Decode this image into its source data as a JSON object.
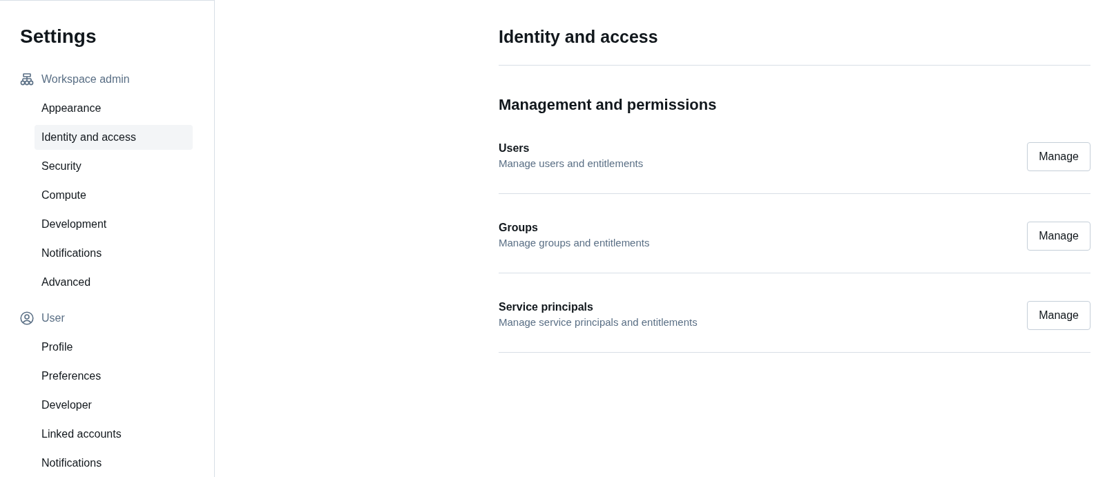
{
  "sidebar": {
    "title": "Settings",
    "sections": [
      {
        "label": "Workspace admin",
        "kind": "workspace",
        "items": [
          {
            "label": "Appearance",
            "selected": false
          },
          {
            "label": "Identity and access",
            "selected": true
          },
          {
            "label": "Security",
            "selected": false
          },
          {
            "label": "Compute",
            "selected": false
          },
          {
            "label": "Development",
            "selected": false
          },
          {
            "label": "Notifications",
            "selected": false
          },
          {
            "label": "Advanced",
            "selected": false
          }
        ]
      },
      {
        "label": "User",
        "kind": "user",
        "items": [
          {
            "label": "Profile",
            "selected": false
          },
          {
            "label": "Preferences",
            "selected": false
          },
          {
            "label": "Developer",
            "selected": false
          },
          {
            "label": "Linked accounts",
            "selected": false
          },
          {
            "label": "Notifications",
            "selected": false
          }
        ]
      }
    ]
  },
  "main": {
    "title": "Identity and access",
    "section_title": "Management and permissions",
    "rows": [
      {
        "title": "Users",
        "description": "Manage users and entitlements",
        "button": "Manage"
      },
      {
        "title": "Groups",
        "description": "Manage groups and entitlements",
        "button": "Manage"
      },
      {
        "title": "Service principals",
        "description": "Manage service principals and entitlements",
        "button": "Manage"
      }
    ]
  }
}
